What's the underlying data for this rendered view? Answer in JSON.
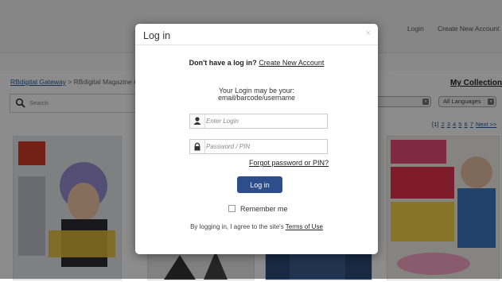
{
  "header": {
    "login_link": "Login",
    "create_account_link": "Create New Account"
  },
  "breadcrumb": {
    "gateway": "RBdigital Gateway",
    "separator": ">",
    "current": "RBdigital Magazine Co"
  },
  "my_collection": "My Collection",
  "search": {
    "placeholder": "Search"
  },
  "language_filter": {
    "selected": "All Languages"
  },
  "pager": {
    "current": "[1]",
    "pages": [
      "2",
      "3",
      "4",
      "5",
      "6",
      "7"
    ],
    "next": "Next >>"
  },
  "modal": {
    "title": "Log in",
    "close": "×",
    "no_account_prompt": "Don't have a log in?",
    "create_account_link": "Create New Account",
    "hint_line1": "Your Login may be your:",
    "hint_line2": "email/barcode/username",
    "login_placeholder": "Enter Login",
    "password_placeholder": "Password / PIN",
    "forgot_link": "Forgot password or PIN?",
    "login_button": "Log in",
    "remember_label": "Remember me",
    "agree_text": "By logging in, I agree to the site's",
    "terms_link": "Terms of Use"
  },
  "colors": {
    "primary_button": "#2d4e8a",
    "link": "#1f5aa0",
    "overlay": "rgba(0,0,0,0.45)"
  }
}
